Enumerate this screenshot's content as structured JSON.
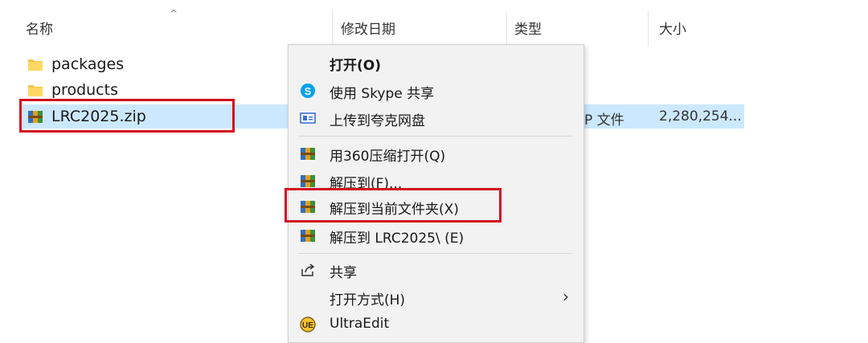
{
  "columns": {
    "name": "名称",
    "date": "修改日期",
    "type": "类型",
    "size": "大小",
    "sort_indicator": "^"
  },
  "files": [
    {
      "name": "packages",
      "icon": "folder-icon"
    },
    {
      "name": "products",
      "icon": "folder-icon"
    },
    {
      "name": "LRC2025.zip",
      "icon": "archive-icon",
      "type": "IP 文件",
      "size": "2,280,254..."
    }
  ],
  "menu": {
    "open": "打开(O)",
    "skype_share": "使用 Skype 共享",
    "upload_quark": "上传到夸克网盘",
    "open_360": "用360压缩打开(Q)",
    "extract_to": "解压到(F)...",
    "extract_here": "解压到当前文件夹(X)",
    "extract_folder": "解压到 LRC2025\\ (E)",
    "share": "共享",
    "open_with": "打开方式(H)",
    "ultraedit": "UltraEdit"
  },
  "colors": {
    "selection": "#cce8ff",
    "highlight": "#d0101f",
    "folder": "#f5c542",
    "menu_bg": "#f2f2f2"
  }
}
